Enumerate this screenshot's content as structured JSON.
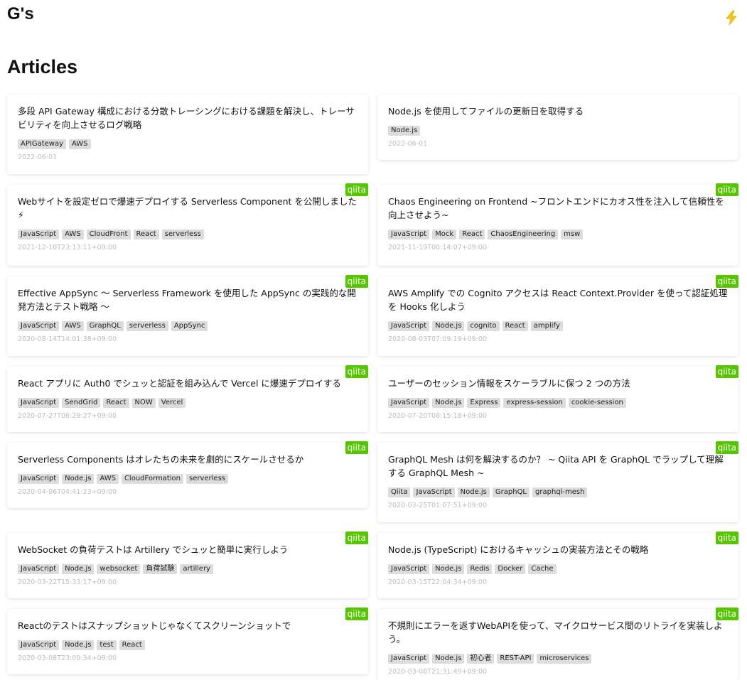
{
  "site": {
    "title": "G's",
    "theme_icon": "lightning-bolt-icon"
  },
  "section": {
    "title": "Articles"
  },
  "colors": {
    "qiita_badge": "#55c500",
    "tag_bg": "#dcdcdc",
    "date": "#bdbdbd"
  },
  "articles": [
    {
      "title": "多段 API Gateway 構成における分散トレーシングにおける課題を解決し、トレーサビリティを向上させるログ戦略",
      "tags": [
        "APIGateway",
        "AWS"
      ],
      "date": "2022-06-01",
      "source": ""
    },
    {
      "title": "Node.js を使用してファイルの更新日を取得する",
      "tags": [
        "Node.js"
      ],
      "date": "2022-06-01",
      "source": ""
    },
    {
      "title": "Webサイトを設定ゼロで爆速デプロイする Serverless Component を公開しました⚡",
      "tags": [
        "JavaScript",
        "AWS",
        "CloudFront",
        "React",
        "serverless"
      ],
      "date": "2021-12-10T23:13:11+09:00",
      "source": "qiita"
    },
    {
      "title": "Chaos Engineering on Frontend ~フロントエンドにカオス性を注入して信頼性を向上させよう~",
      "tags": [
        "JavaScript",
        "Mock",
        "React",
        "ChaosEngineering",
        "msw"
      ],
      "date": "2021-11-19T00:14:07+09:00",
      "source": "qiita"
    },
    {
      "title": "Effective AppSync 〜 Serverless Framework を使用した AppSync の実践的な開発方法とテスト戦略 〜",
      "tags": [
        "JavaScript",
        "AWS",
        "GraphQL",
        "serverless",
        "AppSync"
      ],
      "date": "2020-08-14T14:01:38+09:00",
      "source": "qiita"
    },
    {
      "title": "AWS Amplify での Cognito アクセスは React Context.Provider を使って認証処理を Hooks 化しよう",
      "tags": [
        "JavaScript",
        "Node.js",
        "cognito",
        "React",
        "amplify"
      ],
      "date": "2020-08-03T07:09:19+09:00",
      "source": "qiita"
    },
    {
      "title": "React アプリに Auth0 でシュッと認証を組み込んで Vercel に爆速デプロイする",
      "tags": [
        "JavaScript",
        "SendGrid",
        "React",
        "NOW",
        "Vercel"
      ],
      "date": "2020-07-27T06:29:27+09:00",
      "source": "qiita"
    },
    {
      "title": "ユーザーのセッション情報をスケーラブルに保つ 2 つの方法",
      "tags": [
        "JavaScript",
        "Node.js",
        "Express",
        "express-session",
        "cookie-session"
      ],
      "date": "2020-07-20T08:15:18+09:00",
      "source": "qiita"
    },
    {
      "title": "Serverless Components はオレたちの未来を劇的にスケールさせるか",
      "tags": [
        "JavaScript",
        "Node.js",
        "AWS",
        "CloudFormation",
        "serverless"
      ],
      "date": "2020-04-06T04:41:23+09:00",
      "source": "qiita"
    },
    {
      "title": "GraphQL Mesh は何を解決するのか？ ~ Qiita API を GraphQL でラップして理解する GraphQL Mesh ~",
      "tags": [
        "Qiita",
        "JavaScript",
        "Node.js",
        "GraphQL",
        "graphql-mesh"
      ],
      "date": "2020-03-25T01:07:51+09:00",
      "source": "qiita"
    },
    {
      "title": "WebSocket の負荷テストは Artillery でシュッと簡単に実行しよう",
      "tags": [
        "JavaScript",
        "Node.js",
        "websocket",
        "負荷試験",
        "artillery"
      ],
      "date": "2020-03-22T15:33:17+09:00",
      "source": "qiita"
    },
    {
      "title": "Node.js (TypeScript) におけるキャッシュの実装方法とその戦略",
      "tags": [
        "JavaScript",
        "Node.js",
        "Redis",
        "Docker",
        "Cache"
      ],
      "date": "2020-03-15T22:04:34+09:00",
      "source": "qiita"
    },
    {
      "title": "Reactのテストはスナップショットじゃなくてスクリーンショットで",
      "tags": [
        "JavaScript",
        "Node.js",
        "test",
        "React"
      ],
      "date": "2020-03-08T23:09:34+09:00",
      "source": "qiita"
    },
    {
      "title": "不規則にエラーを返すWebAPIを使って、マイクロサービス間のリトライを実装しよう。",
      "tags": [
        "JavaScript",
        "Node.js",
        "初心者",
        "REST-API",
        "microservices"
      ],
      "date": "2020-03-08T21:31:49+09:00",
      "source": "qiita"
    }
  ]
}
